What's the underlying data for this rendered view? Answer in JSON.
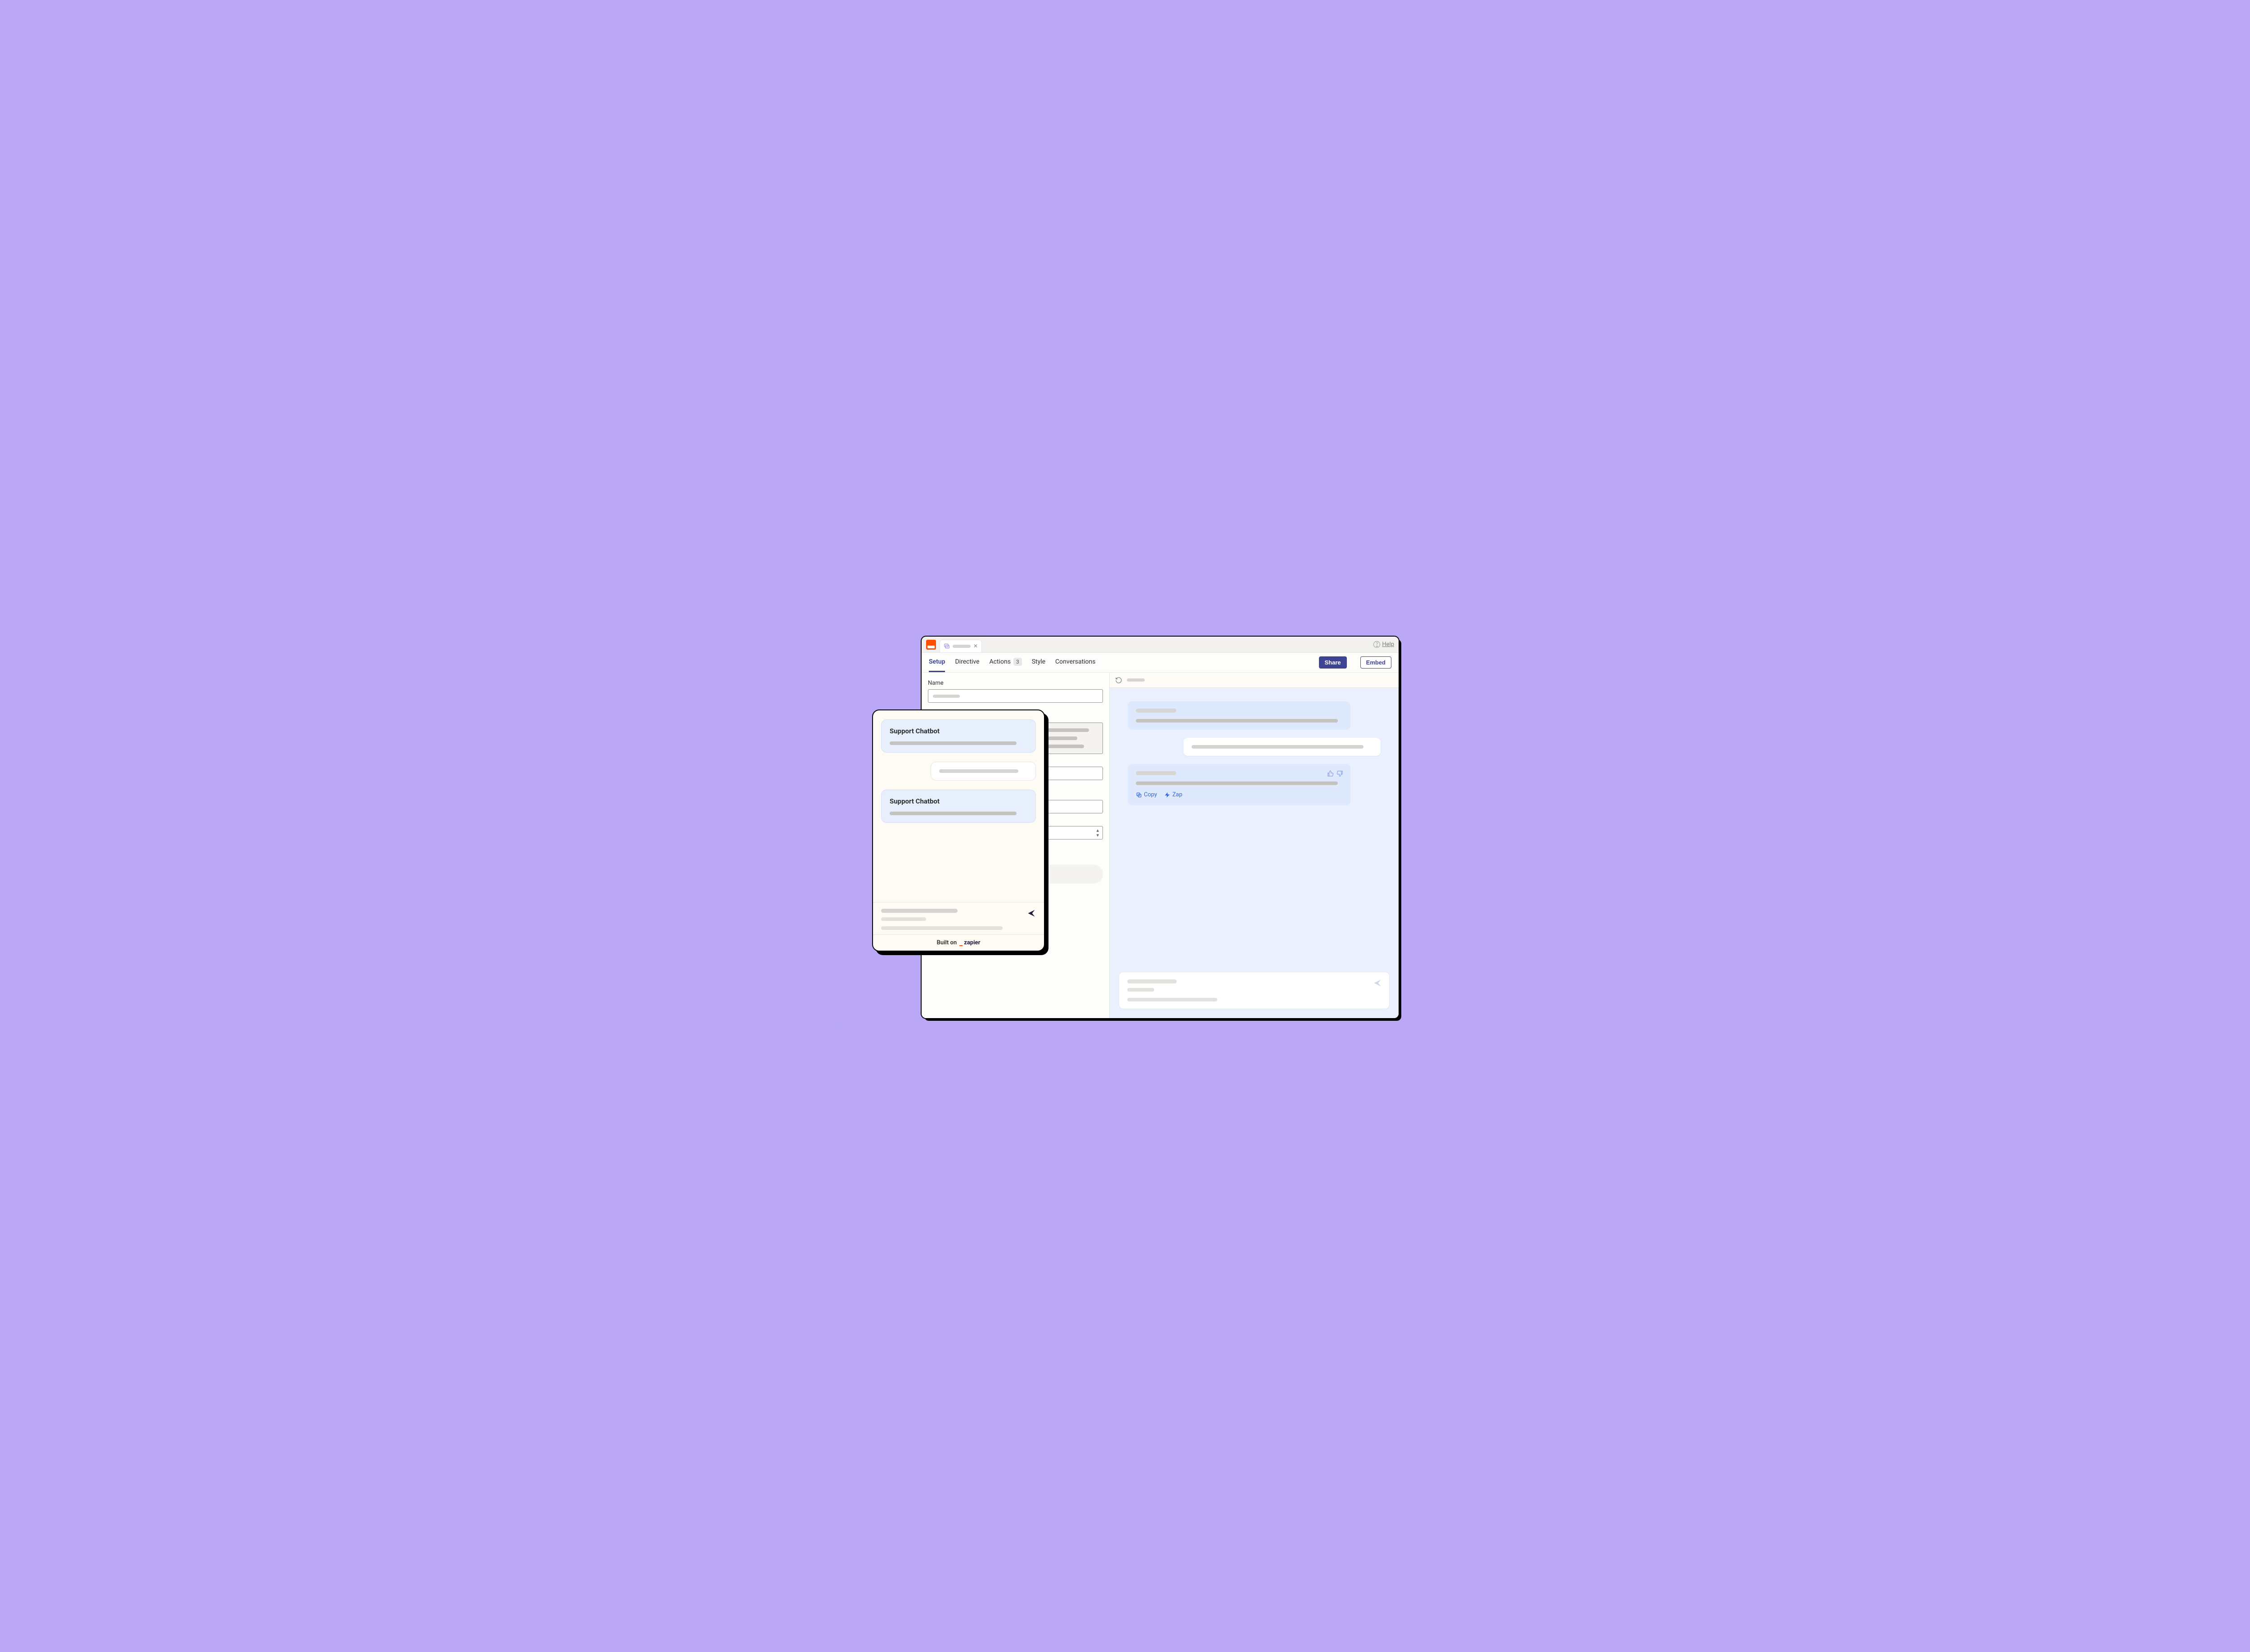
{
  "topbar": {
    "help_label": "Help"
  },
  "nav": {
    "setup": "Setup",
    "directive": "Directive",
    "actions": "Actions",
    "actions_count": "3",
    "style": "Style",
    "conversations": "Conversations",
    "share": "Share",
    "embed": "Embed"
  },
  "form": {
    "name_label": "Name"
  },
  "chat_actions": {
    "copy": "Copy",
    "zap": "Zap"
  },
  "widget": {
    "bot_name": "Support Chatbot",
    "footer_prefix": "Built on",
    "footer_brand": "zapier"
  }
}
